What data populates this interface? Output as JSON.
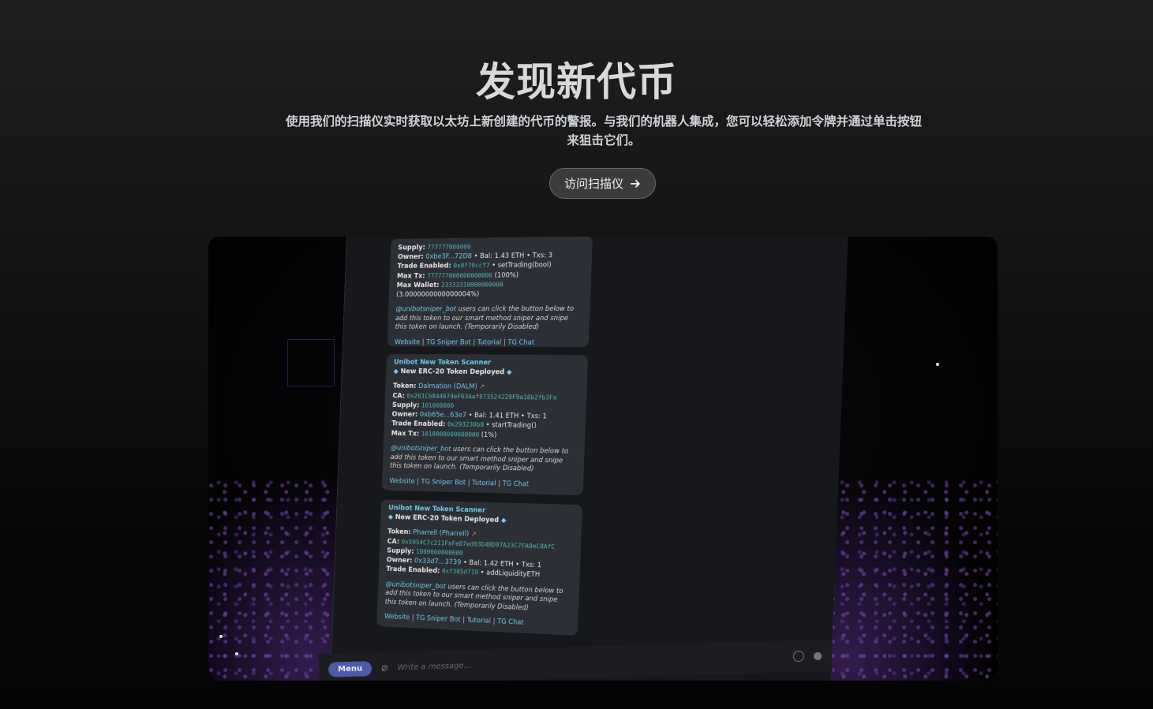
{
  "hero": {
    "title": "发现新代币",
    "subtitle": "使用我们的扫描仪实时获取以太坊上新创建的代币的警报。与我们的机器人集成，您可以轻松添加令牌并通过单击按钮来狙击它们。",
    "cta_label": "访问扫描仪"
  },
  "screenshot": {
    "messages": [
      {
        "fields": [
          {
            "k": "Supply:",
            "v": "777777000000"
          },
          {
            "k": "Owner:",
            "v": "0xbe3F...72D8",
            "extra": " • Bal: 1.43 ETH • Txs: 3"
          },
          {
            "k": "Trade Enabled:",
            "v": "0x8f70ccf7",
            "extra": " • setTrading(bool)"
          },
          {
            "k": "Max Tx:",
            "v": "777777000000000000",
            "extra": " (100%)"
          },
          {
            "k": "Max Wallet:",
            "v": "23333310000000000",
            "extra": " (3.0000000000000004%)"
          }
        ],
        "bot": "@unibotsniper_bot",
        "note": " users can click the button below to add this token to our smart method sniper and snipe this token on launch. (Temporarily Disabled)"
      },
      {
        "header": "Unibot New Token Scanner",
        "subheader": "New ERC-20 Token Deployed",
        "token": "Dalmation (DALM)",
        "fields": [
          {
            "k": "CA:",
            "v": "0x261C6844674eF63Aef873524229F9a18b2fb3Fa"
          },
          {
            "k": "Supply:",
            "v": "101000000"
          },
          {
            "k": "Owner:",
            "v": "0xb65e...63e7",
            "extra": " • Bal: 1.41 ETH • Txs: 1"
          },
          {
            "k": "Trade Enabled:",
            "v": "0x293230b8",
            "extra": " • startTrading()"
          },
          {
            "k": "Max Tx:",
            "v": "1010000000000000",
            "extra": " (1%)"
          }
        ],
        "bot": "@unibotsniper_bot",
        "note": " users can click the button below to add this token to our smart method sniper and snipe this token on launch. (Temporarily Disabled)"
      },
      {
        "header": "Unibot New Token Scanner",
        "subheader": "New ERC-20 Token Deployed",
        "token": "Pharrell (Pharrell)",
        "fields": [
          {
            "k": "CA:",
            "v": "0x5954C7c211FaFeD7ed03D4BD97A23C7FA0eC8AfC"
          },
          {
            "k": "Supply:",
            "v": "1000000000000"
          },
          {
            "k": "Owner:",
            "v": "0x33d7...3739",
            "extra": " • Bal: 1.42 ETH • Txs: 1"
          },
          {
            "k": "Trade Enabled:",
            "v": "0xf305d719",
            "extra": " • addLiquidityETH"
          }
        ],
        "bot": "@unibotsniper_bot",
        "note": " users can click the button below to add this token to our smart method sniper and snipe this token on launch. (Temporarily Disabled)"
      }
    ],
    "links": [
      "Website",
      "TG Sniper Bot",
      "Tutorial",
      "TG Chat"
    ],
    "token_label": "Token:",
    "menu_label": "Menu",
    "composer_placeholder": "Write a message..."
  }
}
